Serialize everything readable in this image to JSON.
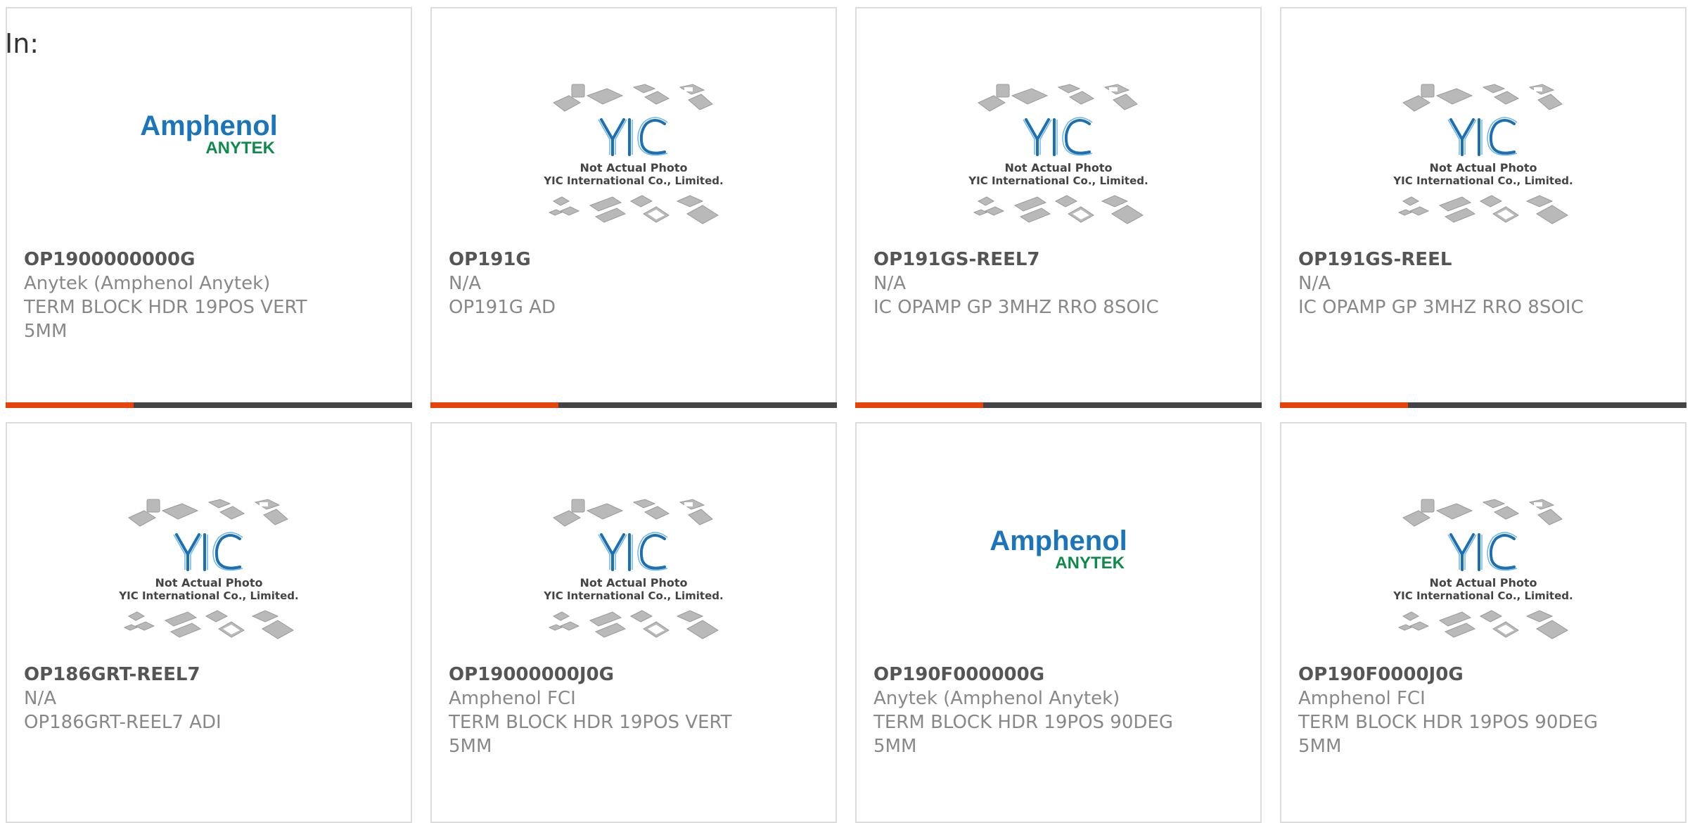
{
  "page": {
    "in_label": "In:"
  },
  "placeholder_image": {
    "caption_line1": "Not Actual Photo",
    "caption_line2": "YIC International Co., Limited.",
    "logo_text": "YIC"
  },
  "brand_logo": {
    "name": "Amphenol",
    "sub": "ANYTEK",
    "name_color": "#1a75bb",
    "sub_color": "#0e8a4a"
  },
  "colors": {
    "accent": "#e8410c",
    "bar": "#444444"
  },
  "products": [
    {
      "part_number": "OP1900000000G",
      "manufacturer": "Anytek (Amphenol Anytek)",
      "description_line1": "TERM BLOCK HDR 19POS VERT",
      "description_line2": "5MM",
      "image": "brand-logo",
      "has_bar": true
    },
    {
      "part_number": "OP191G",
      "manufacturer": "N/A",
      "description_line1": "OP191G AD",
      "description_line2": "",
      "image": "placeholder",
      "has_bar": true
    },
    {
      "part_number": "OP191GS-REEL7",
      "manufacturer": "N/A",
      "description_line1": "IC OPAMP GP 3MHZ RRO 8SOIC",
      "description_line2": "",
      "image": "placeholder",
      "has_bar": true
    },
    {
      "part_number": "OP191GS-REEL",
      "manufacturer": "N/A",
      "description_line1": "IC OPAMP GP 3MHZ RRO 8SOIC",
      "description_line2": "",
      "image": "placeholder",
      "has_bar": true
    },
    {
      "part_number": "OP186GRT-REEL7",
      "manufacturer": "N/A",
      "description_line1": "OP186GRT-REEL7 ADI",
      "description_line2": "",
      "image": "placeholder",
      "has_bar": false
    },
    {
      "part_number": "OP19000000J0G",
      "manufacturer": "Amphenol FCI",
      "description_line1": "TERM BLOCK HDR 19POS VERT",
      "description_line2": "5MM",
      "image": "placeholder",
      "has_bar": false
    },
    {
      "part_number": "OP190F000000G",
      "manufacturer": "Anytek (Amphenol Anytek)",
      "description_line1": "TERM BLOCK HDR 19POS 90DEG",
      "description_line2": "5MM",
      "image": "brand-logo",
      "has_bar": false
    },
    {
      "part_number": "OP190F0000J0G",
      "manufacturer": "Amphenol FCI",
      "description_line1": "TERM BLOCK HDR 19POS 90DEG",
      "description_line2": "5MM",
      "image": "placeholder",
      "has_bar": false
    }
  ]
}
